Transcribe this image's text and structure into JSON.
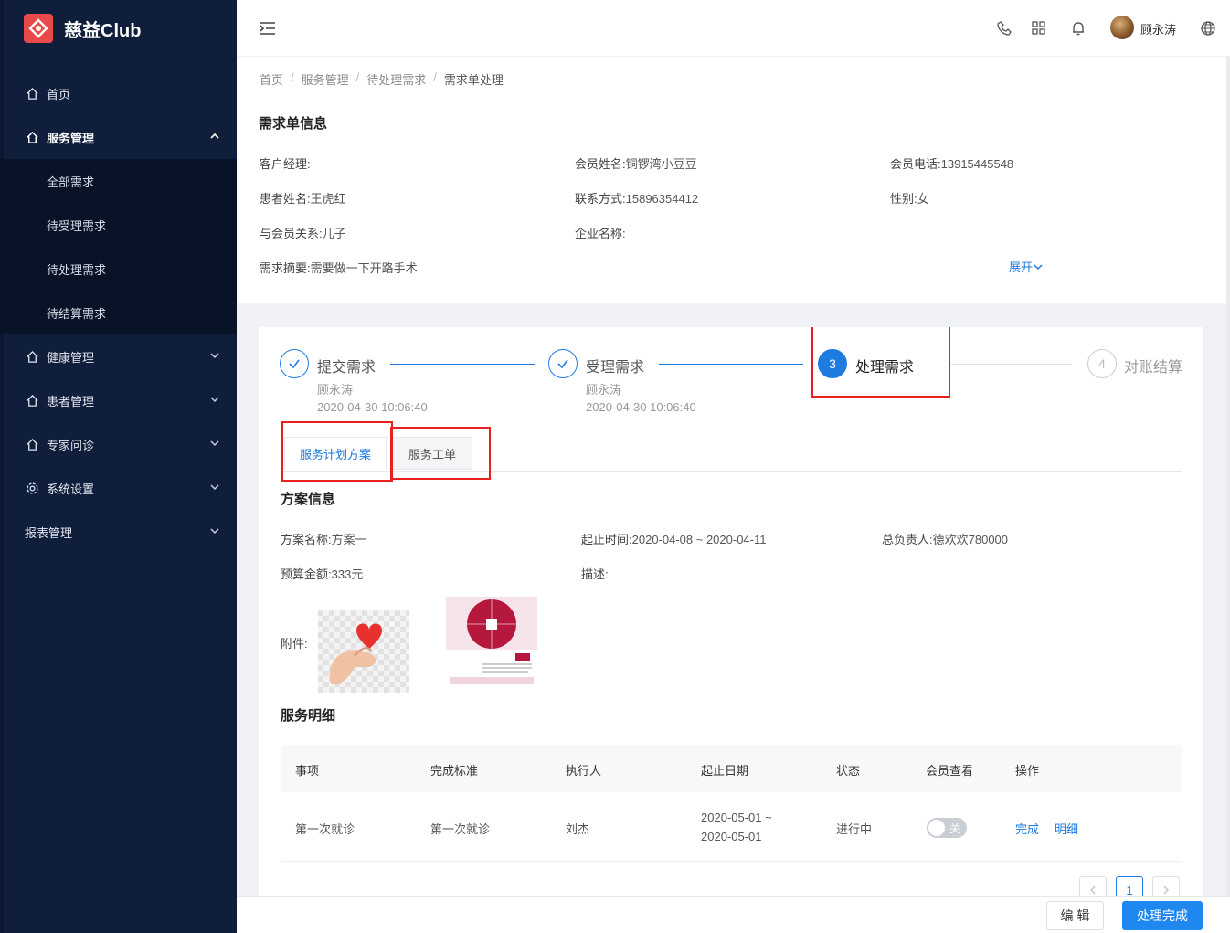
{
  "app": {
    "name": "慈益Club"
  },
  "sidebar": {
    "items": [
      {
        "label": "首页",
        "icon": "home-icon"
      },
      {
        "label": "服务管理",
        "icon": "home-icon"
      },
      {
        "label": "健康管理",
        "icon": "home-icon"
      },
      {
        "label": "患者管理",
        "icon": "home-icon"
      },
      {
        "label": "专家问诊",
        "icon": "home-icon"
      },
      {
        "label": "系统设置",
        "icon": "gear-icon"
      },
      {
        "label": "报表管理",
        "icon": ""
      }
    ],
    "submenu": [
      "全部需求",
      "待受理需求",
      "待处理需求",
      "待结算需求"
    ]
  },
  "topbar": {
    "username": "顾永涛"
  },
  "breadcrumb": [
    "首页",
    "服务管理",
    "待处理需求",
    "需求单处理"
  ],
  "request_info": {
    "title": "需求单信息",
    "account_manager": {
      "label": "客户经理:",
      "value": ""
    },
    "member_name": {
      "label": "会员姓名:",
      "value": "铜锣湾小豆豆"
    },
    "member_phone": {
      "label": "会员电话:",
      "value": "13915445548"
    },
    "patient_name": {
      "label": "患者姓名:",
      "value": "王虎红"
    },
    "contact": {
      "label": "联系方式:",
      "value": "15896354412"
    },
    "gender": {
      "label": "性别:",
      "value": "女"
    },
    "relation": {
      "label": "与会员关系:",
      "value": "儿子"
    },
    "company": {
      "label": "企业名称:",
      "value": ""
    },
    "summary": {
      "label": "需求摘要:",
      "value": "需要做一下开路手术"
    },
    "expand_label": "展开"
  },
  "steps": [
    {
      "index": "1",
      "title": "提交需求",
      "person": "顾永涛",
      "time": "2020-04-30 10:06:40",
      "status": "finish"
    },
    {
      "index": "2",
      "title": "受理需求",
      "person": "顾永涛",
      "time": "2020-04-30 10:06:40",
      "status": "finish"
    },
    {
      "index": "3",
      "title": "处理需求",
      "person": "",
      "time": "",
      "status": "process"
    },
    {
      "index": "4",
      "title": "对账结算",
      "person": "",
      "time": "",
      "status": "wait"
    }
  ],
  "tabs": [
    "服务计划方案",
    "服务工单"
  ],
  "plan": {
    "title": "方案信息",
    "name": {
      "label": "方案名称:",
      "value": "方案一"
    },
    "period": {
      "label": "起止时间:",
      "value": "2020-04-08 ~ 2020-04-11"
    },
    "owner": {
      "label": "总负责人:",
      "value": "德欢欢780000"
    },
    "budget": {
      "label": "预算金额:",
      "value": "333元"
    },
    "description": {
      "label": "描述:",
      "value": ""
    },
    "attachments_label": "附件:"
  },
  "service_detail": {
    "title": "服务明细",
    "columns": [
      "事项",
      "完成标准",
      "执行人",
      "起止日期",
      "状态",
      "会员查看",
      "操作"
    ],
    "rows": [
      {
        "item": "第一次就诊",
        "standard": "第一次就诊",
        "executor": "刘杰",
        "date_start": "2020-05-01 ~",
        "date_end": "2020-05-01",
        "status": "进行中",
        "toggle_label": "关",
        "actions": [
          "完成",
          "明细"
        ]
      }
    ]
  },
  "pagination": {
    "current": "1"
  },
  "footer": {
    "edit_label": "编 辑",
    "done_label": "处理完成"
  },
  "colors": {
    "primary": "#1e7be0",
    "sidebar_bg": "#0f1e3a",
    "highlight_box": "#e8211e",
    "logo": "#e84a4a"
  }
}
